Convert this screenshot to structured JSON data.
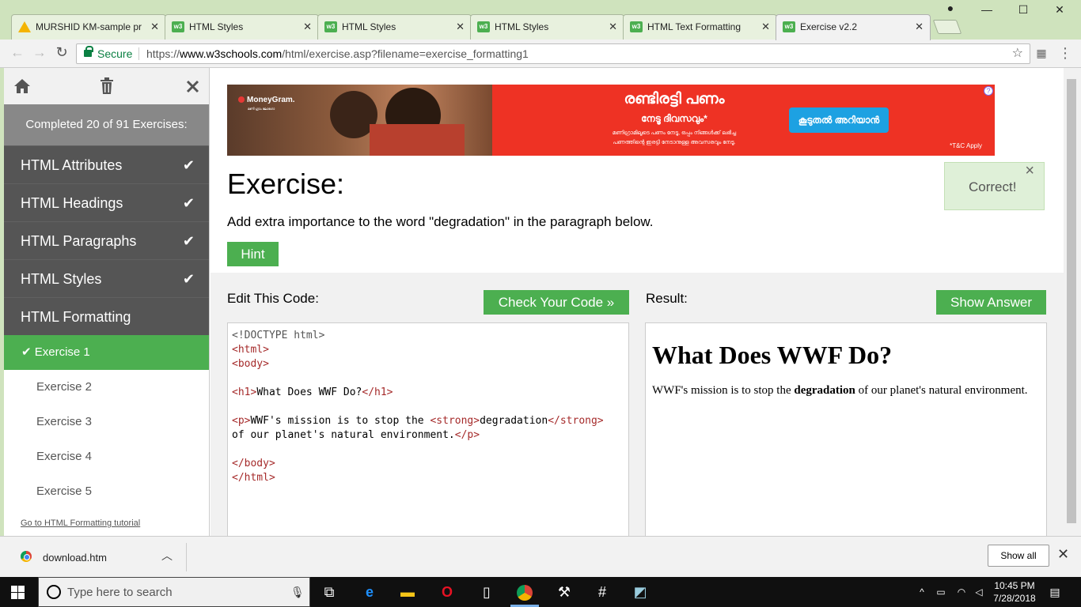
{
  "browser": {
    "tabs": [
      {
        "title": "MURSHID KM-sample pr",
        "icon": "drive-icon"
      },
      {
        "title": "HTML Styles",
        "icon": "w3-icon"
      },
      {
        "title": "HTML Styles",
        "icon": "w3-icon"
      },
      {
        "title": "HTML Styles",
        "icon": "w3-icon"
      },
      {
        "title": "HTML Text Formatting",
        "icon": "w3-icon"
      },
      {
        "title": "Exercise v2.2",
        "icon": "w3-icon",
        "active": true
      }
    ],
    "secure_label": "Secure",
    "url_prefix": "https://",
    "url_host": "www.w3schools.com",
    "url_path": "/html/exercise.asp?filename=exercise_formatting1"
  },
  "sidebar": {
    "completed": "Completed 20 of 91 Exercises:",
    "categories": [
      {
        "label": "HTML Attributes",
        "done": true
      },
      {
        "label": "HTML Headings",
        "done": true
      },
      {
        "label": "HTML Paragraphs",
        "done": true
      },
      {
        "label": "HTML Styles",
        "done": true
      },
      {
        "label": "HTML Formatting",
        "done": false
      }
    ],
    "exercises": [
      "Exercise 1",
      "Exercise 2",
      "Exercise 3",
      "Exercise 4",
      "Exercise 5"
    ],
    "tutorial_link": "Go to HTML Formatting tutorial"
  },
  "ad": {
    "brand": "MoneyGram.",
    "brand_sub": "മണി ഗ്രാം ലോഗോ",
    "headline": "രണ്ടിരട്ടി പണം",
    "subheadline": "നേടൂ ദിവസവും*",
    "body_line1": "മണിഗ്രാമിലൂടെ പണം നേടൂ, ഒപ്പം നിങ്ങൾക്ക് ലഭിച്ച",
    "body_line2": "പണത്തിന്റെ ഇരട്ടി നേടാനുള്ള അവസരവും നേടൂ.",
    "cta": "കൂടുതൽ അറിയാൻ",
    "tc": "*T&C Apply",
    "info": "?"
  },
  "exercise": {
    "title": "Exercise:",
    "description": "Add extra importance to the word \"degradation\" in the paragraph below.",
    "hint_label": "Hint",
    "correct_label": "Correct!",
    "edit_label": "Edit This Code:",
    "check_label": "Check Your Code »",
    "result_label": "Result:",
    "answer_label": "Show Answer"
  },
  "code": {
    "doctype": "<!DOCTYPE html>",
    "html_open": "<html>",
    "body_open": "<body>",
    "h1_open": "<h1>",
    "h1_text": "What Does WWF Do?",
    "h1_close": "</h1>",
    "p_open": "<p>",
    "p_text1": "WWF's mission is to stop the ",
    "strong_open": "<strong>",
    "strong_text": "degradation",
    "strong_close": "</strong>",
    "p_text2": "of our planet's natural environment.",
    "p_close": "</p>",
    "body_close": "</body>",
    "html_close": "</html>"
  },
  "result": {
    "heading": "What Does WWF Do?",
    "p_before": "WWF's mission is to stop the ",
    "p_strong": "degradation",
    "p_after": " of our planet's natural environment."
  },
  "download": {
    "filename": "download.htm",
    "show_all": "Show all"
  },
  "taskbar": {
    "search_placeholder": "Type here to search",
    "time": "10:45 PM",
    "date": "7/28/2018"
  },
  "colors": {
    "w3_green": "#4caf50",
    "sidebar_dark": "#555555",
    "ad_red": "#ee3224",
    "correct_bg": "#dff0d8"
  }
}
